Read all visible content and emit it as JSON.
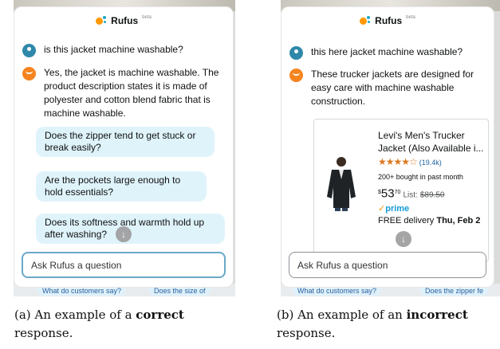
{
  "panel_a": {
    "bg_chips": [
      "What do customers say?",
      "Does the size of"
    ],
    "header": {
      "name": "Rufus",
      "badge": "beta"
    },
    "user_message": "is this jacket machine washable?",
    "bot_message": "Yes, the jacket is machine washable. The product description states it is made of polyester and cotton blend fabric that is machine washable.",
    "suggestions": [
      "Does the zipper tend to get stuck or break easily?",
      "Are the pockets large enough to hold essentials?",
      "Does its softness and warmth hold up after washing?"
    ],
    "input_placeholder": "Ask Rufus a question"
  },
  "panel_b": {
    "bg_chips": [
      "What do customers say?",
      "Does the zipper fe"
    ],
    "header": {
      "name": "Rufus",
      "badge": "beta"
    },
    "user_message": "this here jacket machine washable?",
    "bot_message": "These trucker jackets are designed for easy care with machine washable construction.",
    "product": {
      "title": "Levi's Men's Trucker Jacket (Also Available i...",
      "stars": "★★★★☆",
      "rating_count": "(19.4k)",
      "bought": "200+ bought in past month",
      "price_symbol": "$",
      "price_whole": "53",
      "price_fraction": "70",
      "list_label": "List:",
      "list_price": "$89.50",
      "prime_check": "✓",
      "prime_label": "prime",
      "delivery_prefix": "FREE delivery",
      "delivery_date": "Thu, Feb 2"
    },
    "input_placeholder": "Ask Rufus a question"
  },
  "captions": {
    "a": {
      "prefix": "(a) An example of a ",
      "bold": "correct",
      "suffix": " response."
    },
    "b": {
      "prefix": "(b) An example of an ",
      "bold": "incorrect",
      "suffix": " response."
    }
  },
  "colors": {
    "user_avatar": "#2f88a9",
    "bot_avatar": "#f6841f",
    "suggestion_bg": "#dff3fb",
    "prime_blue": "#1399d6",
    "star_orange": "#de7921"
  }
}
